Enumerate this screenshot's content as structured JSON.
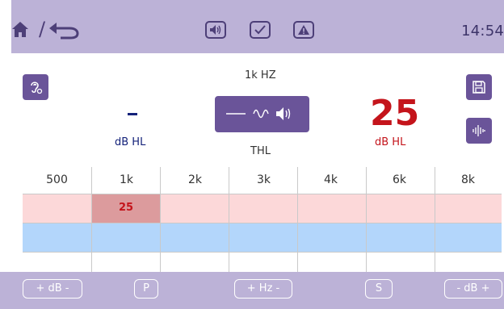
{
  "topbar": {
    "slash": "/",
    "clock": "14:54",
    "icons": [
      "home-icon",
      "back-icon",
      "speaker-icon",
      "check-icon",
      "warning-icon"
    ]
  },
  "test": {
    "frequency_label": "1k HZ",
    "left_value": "-",
    "left_unit": "dB HL",
    "stimulus_label": "THL",
    "right_value": "25",
    "right_unit": "dB HL"
  },
  "table": {
    "columns": [
      "500",
      "1k",
      "2k",
      "3k",
      "4k",
      "6k",
      "8k"
    ],
    "selected_cell_value": "25"
  },
  "bottombar": {
    "db_label": "+ dB -",
    "p_label": "P",
    "hz_label": "+ Hz -",
    "s_label": "S",
    "db2_label": "- dB +"
  },
  "colors": {
    "accent": "#6a5499",
    "bar": "#bcb2d7",
    "value_red": "#c4141b",
    "value_blue": "#14227a"
  }
}
